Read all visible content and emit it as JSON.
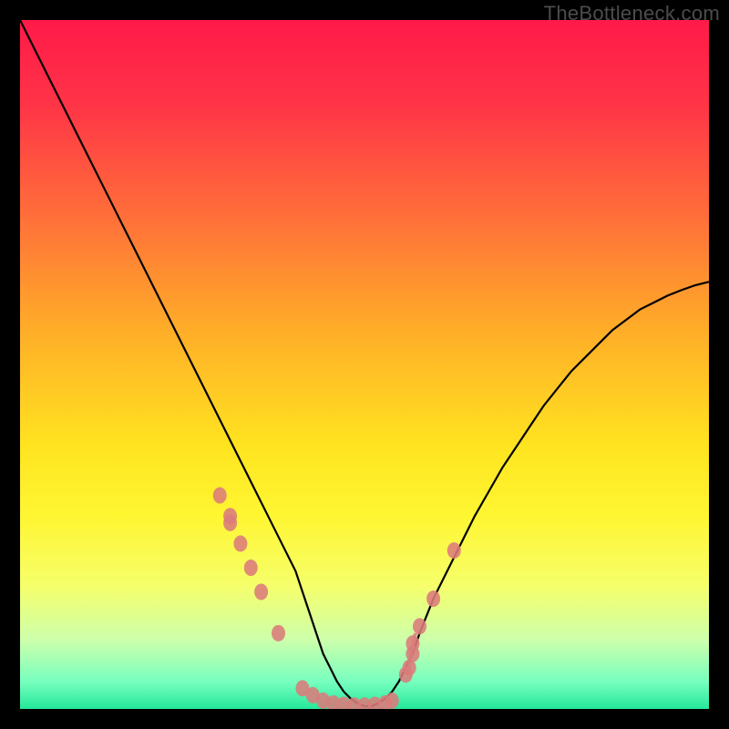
{
  "watermark": "TheBottleneck.com",
  "colors": {
    "gradient_stops": [
      {
        "offset": 0.0,
        "color": "#ff1a49"
      },
      {
        "offset": 0.12,
        "color": "#ff3347"
      },
      {
        "offset": 0.28,
        "color": "#ff6d3a"
      },
      {
        "offset": 0.45,
        "color": "#ffad28"
      },
      {
        "offset": 0.62,
        "color": "#ffe420"
      },
      {
        "offset": 0.72,
        "color": "#fff632"
      },
      {
        "offset": 0.82,
        "color": "#f6ff6a"
      },
      {
        "offset": 0.9,
        "color": "#cdffab"
      },
      {
        "offset": 0.96,
        "color": "#78ffbf"
      },
      {
        "offset": 1.0,
        "color": "#24e89b"
      }
    ],
    "curve": "#000000",
    "markers": "#db7b7b",
    "frame_bg": "#000000",
    "watermark_text": "#4c4c4c"
  },
  "chart_data": {
    "type": "line",
    "title": "",
    "xlabel": "",
    "ylabel": "",
    "xlim": [
      0,
      100
    ],
    "ylim": [
      0,
      100
    ],
    "grid": false,
    "legend": false,
    "x": [
      0,
      2,
      4,
      6,
      8,
      10,
      12,
      14,
      16,
      18,
      20,
      22,
      24,
      26,
      28,
      30,
      32,
      34,
      36,
      38,
      40,
      41,
      42,
      43,
      44,
      45,
      46,
      47,
      48,
      49,
      50,
      51,
      52,
      53,
      54,
      55,
      56,
      57,
      58,
      60,
      62,
      64,
      66,
      68,
      70,
      72,
      74,
      76,
      78,
      80,
      82,
      84,
      86,
      88,
      90,
      92,
      94,
      96,
      98,
      100
    ],
    "series": [
      {
        "name": "bottleneck-curve",
        "values": [
          100.0,
          96.0,
          92.0,
          88.0,
          84.0,
          80.0,
          76.0,
          72.0,
          68.0,
          64.0,
          60.0,
          56.0,
          52.0,
          48.0,
          44.0,
          40.0,
          36.0,
          32.0,
          28.0,
          24.0,
          20.0,
          17.0,
          14.0,
          11.0,
          8.0,
          6.0,
          4.0,
          2.5,
          1.5,
          0.8,
          0.4,
          0.4,
          0.8,
          1.5,
          2.5,
          4.0,
          6.0,
          8.0,
          11.0,
          16.0,
          20.0,
          24.0,
          28.0,
          31.5,
          35.0,
          38.0,
          41.0,
          44.0,
          46.5,
          49.0,
          51.0,
          53.0,
          55.0,
          56.5,
          58.0,
          59.0,
          60.0,
          60.8,
          61.5,
          62.0
        ]
      }
    ],
    "annotations": [
      {
        "name": "marker-cluster",
        "points_x": [
          29.0,
          30.5,
          30.5,
          32.0,
          33.5,
          35.0,
          37.5,
          41.0,
          42.5,
          44.0,
          45.5,
          47.0,
          48.5,
          50.0,
          51.5,
          53.0,
          54.0,
          56.0,
          57.0,
          56.5,
          57.0,
          58.0,
          60.0,
          63.0
        ],
        "points_y": [
          31.0,
          28.0,
          27.0,
          24.0,
          20.5,
          17.0,
          11.0,
          3.0,
          2.0,
          1.2,
          0.8,
          0.6,
          0.5,
          0.5,
          0.6,
          0.8,
          1.2,
          5.0,
          8.0,
          6.0,
          9.5,
          12.0,
          16.0,
          23.0
        ]
      }
    ]
  }
}
